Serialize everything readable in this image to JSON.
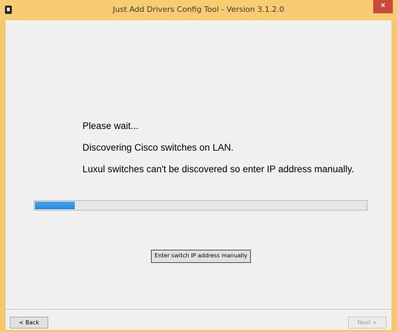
{
  "window": {
    "title": "Just Add Drivers Config Tool - Version 3.1.2.0",
    "close_glyph": "×"
  },
  "main": {
    "messages": [
      "Please wait...",
      "Discovering Cisco switches on LAN.",
      "Luxul switches can't be discovered so enter IP address manually."
    ],
    "progress_fraction": 0.12,
    "manual_button_label": "Enter switch IP address manually"
  },
  "nav": {
    "back_label": "< Back",
    "next_label": "Next >"
  },
  "colors": {
    "accent": "#f8cd72",
    "progress_fill": "#2787d9",
    "close": "#c94a3c"
  }
}
